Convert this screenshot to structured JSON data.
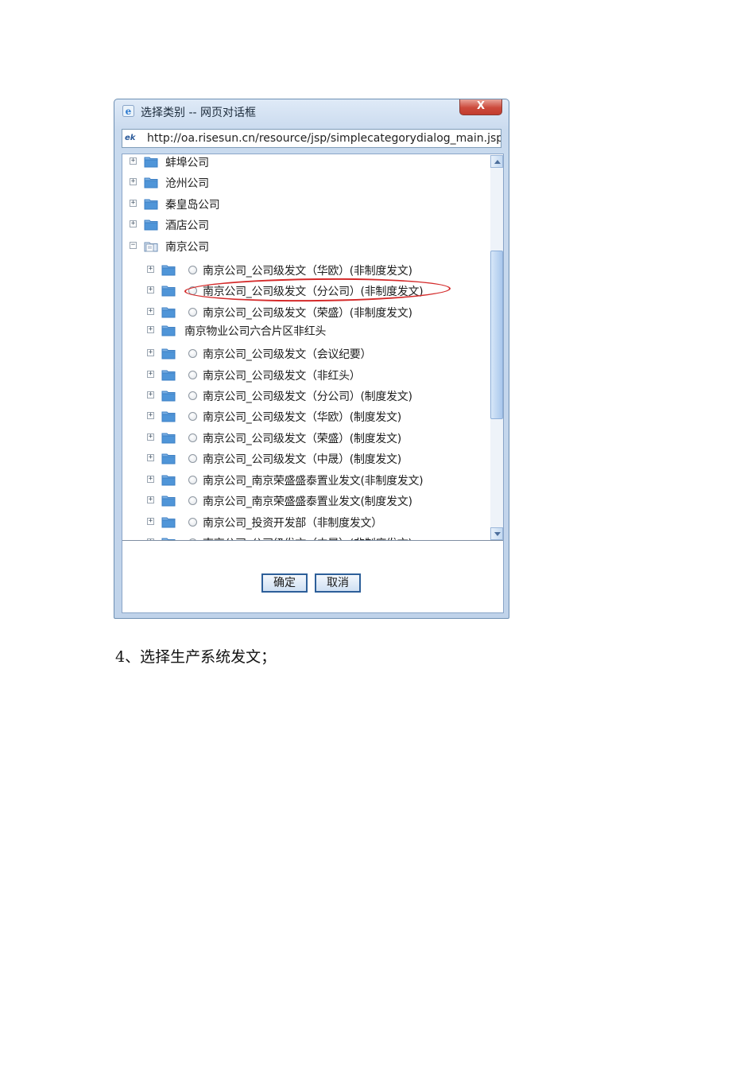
{
  "dialog": {
    "title": "选择类别 -- 网页对话框",
    "close_label": "X",
    "url_icon": "e/ie-page-icon",
    "url": "http://oa.risesun.cn/resource/jsp/simplecategorydialog_main.jsp"
  },
  "tree": {
    "top_nodes": [
      {
        "label": "蚌埠公司",
        "expander": "+"
      },
      {
        "label": "沧州公司",
        "expander": "+"
      },
      {
        "label": "秦皇岛公司",
        "expander": "+"
      },
      {
        "label": "酒店公司",
        "expander": "+"
      },
      {
        "label": "南京公司",
        "expander": "−",
        "expanded": true
      }
    ],
    "children": [
      {
        "label": "南京公司_公司级发文（华欧）(非制度发文)",
        "radio": true
      },
      {
        "label": "南京公司_公司级发文（分公司）(非制度发文)",
        "radio": true,
        "highlighted": true
      },
      {
        "label": "南京公司_公司级发文（荣盛）(非制度发文)",
        "radio": true
      },
      {
        "label": "南京物业公司六合片区非红头",
        "radio": false
      },
      {
        "label": "南京公司_公司级发文（会议纪要）",
        "radio": true
      },
      {
        "label": "南京公司_公司级发文（非红头）",
        "radio": true
      },
      {
        "label": "南京公司_公司级发文（分公司）(制度发文)",
        "radio": true
      },
      {
        "label": "南京公司_公司级发文（华欧）(制度发文)",
        "radio": true
      },
      {
        "label": "南京公司_公司级发文（荣盛）(制度发文)",
        "radio": true
      },
      {
        "label": "南京公司_公司级发文（中晟）(制度发文)",
        "radio": true
      },
      {
        "label": "南京公司_南京荣盛盛泰置业发文(非制度发文)",
        "radio": true
      },
      {
        "label": "南京公司_南京荣盛盛泰置业发文(制度发文)",
        "radio": true
      },
      {
        "label": "南京公司_投资开发部（非制度发文）",
        "radio": true
      },
      {
        "label": "南京公司_公司级发文（中晟）(非制度发文)",
        "radio": true
      }
    ]
  },
  "buttons": {
    "ok": "确定",
    "cancel": "取消"
  },
  "colors": {
    "highlight_ring": "#d42a2a",
    "folder": "#3b7fc4",
    "window_frame": "#c0d3ea"
  },
  "caption": "4、选择生产系统发文；"
}
